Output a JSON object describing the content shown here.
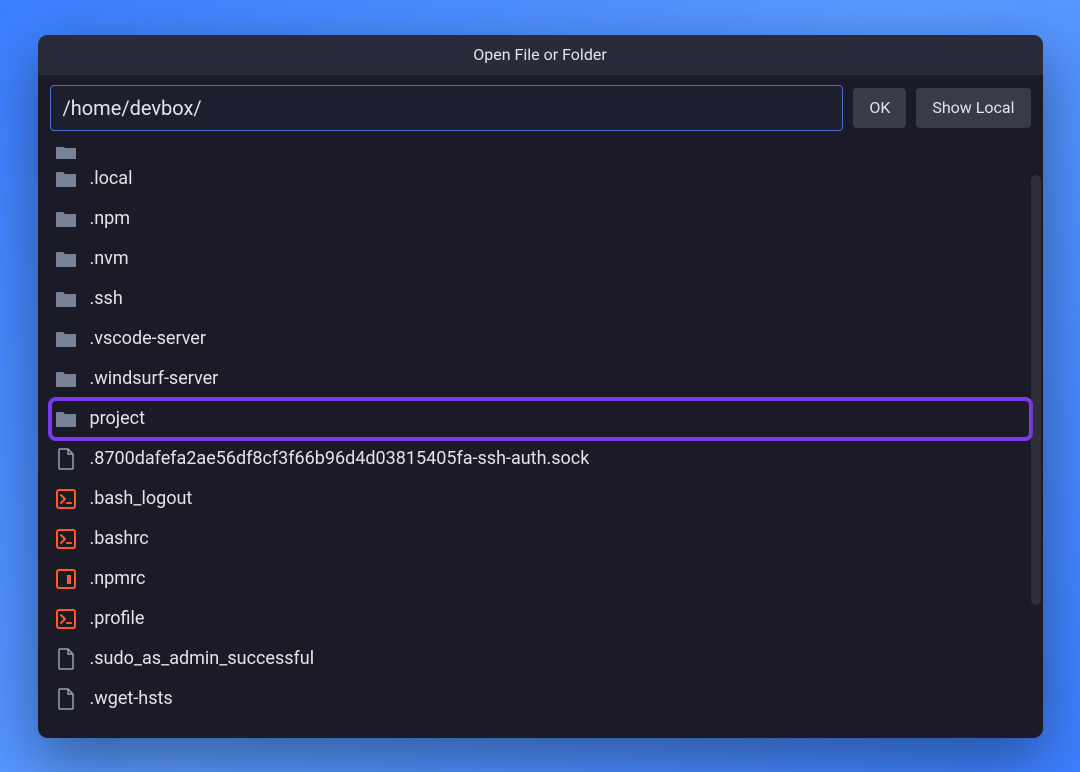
{
  "dialog": {
    "title": "Open File or Folder",
    "path_value": "/home/devbox/",
    "ok_label": "OK",
    "show_local_label": "Show Local"
  },
  "items": [
    {
      "name": ".local",
      "type": "folder",
      "highlighted": false,
      "cutoff": false
    },
    {
      "name": ".npm",
      "type": "folder",
      "highlighted": false,
      "cutoff": false
    },
    {
      "name": ".nvm",
      "type": "folder",
      "highlighted": false,
      "cutoff": false
    },
    {
      "name": ".ssh",
      "type": "folder",
      "highlighted": false,
      "cutoff": false
    },
    {
      "name": ".vscode-server",
      "type": "folder",
      "highlighted": false,
      "cutoff": false
    },
    {
      "name": ".windsurf-server",
      "type": "folder",
      "highlighted": false,
      "cutoff": false
    },
    {
      "name": "project",
      "type": "folder",
      "highlighted": true,
      "cutoff": false
    },
    {
      "name": ".8700dafefa2ae56df8cf3f66b96d4d03815405fa-ssh-auth.sock",
      "type": "file",
      "highlighted": false,
      "cutoff": false
    },
    {
      "name": ".bash_logout",
      "type": "shell",
      "highlighted": false,
      "cutoff": false
    },
    {
      "name": ".bashrc",
      "type": "shell",
      "highlighted": false,
      "cutoff": false
    },
    {
      "name": ".npmrc",
      "type": "npm",
      "highlighted": false,
      "cutoff": false
    },
    {
      "name": ".profile",
      "type": "shell",
      "highlighted": false,
      "cutoff": false
    },
    {
      "name": ".sudo_as_admin_successful",
      "type": "file",
      "highlighted": false,
      "cutoff": false
    },
    {
      "name": ".wget-hsts",
      "type": "file",
      "highlighted": false,
      "cutoff": false
    }
  ],
  "icon_colors": {
    "folder": "#7a8296",
    "file": "#9aa0b0",
    "shell": "#ff5a2c",
    "npm": "#ff5a2c"
  }
}
